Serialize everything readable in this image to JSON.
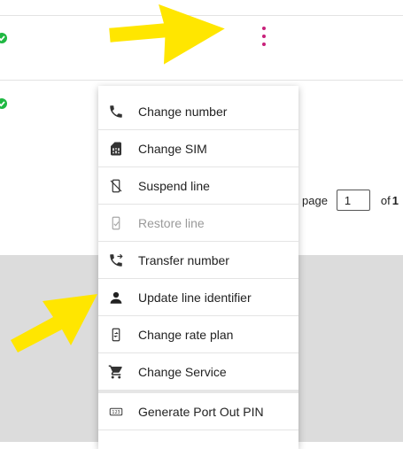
{
  "pager": {
    "page_label": "page",
    "current_page": "1",
    "of_label": "of",
    "total_pages": "1"
  },
  "menu": {
    "items": [
      {
        "label": "Change number",
        "icon": "phone-icon",
        "disabled": false
      },
      {
        "label": "Change SIM",
        "icon": "sim-card-icon",
        "disabled": false
      },
      {
        "label": "Suspend line",
        "icon": "phone-off-icon",
        "disabled": false
      },
      {
        "label": "Restore line",
        "icon": "phone-restore-icon",
        "disabled": true
      },
      {
        "label": "Transfer number",
        "icon": "phone-forward-icon",
        "disabled": false
      },
      {
        "label": "Update line identifier",
        "icon": "person-icon",
        "disabled": false
      },
      {
        "label": "Change rate plan",
        "icon": "phone-sync-icon",
        "disabled": false
      },
      {
        "label": "Change Service",
        "icon": "cart-icon",
        "disabled": false
      },
      {
        "label": "Generate Port Out PIN",
        "icon": "pin-badge-icon",
        "disabled": false
      }
    ]
  },
  "colors": {
    "status_green": "#1fb842",
    "kebab_magenta": "#c8207a",
    "arrow_yellow": "#ffe600",
    "backdrop_grey": "#dcdcdc"
  }
}
